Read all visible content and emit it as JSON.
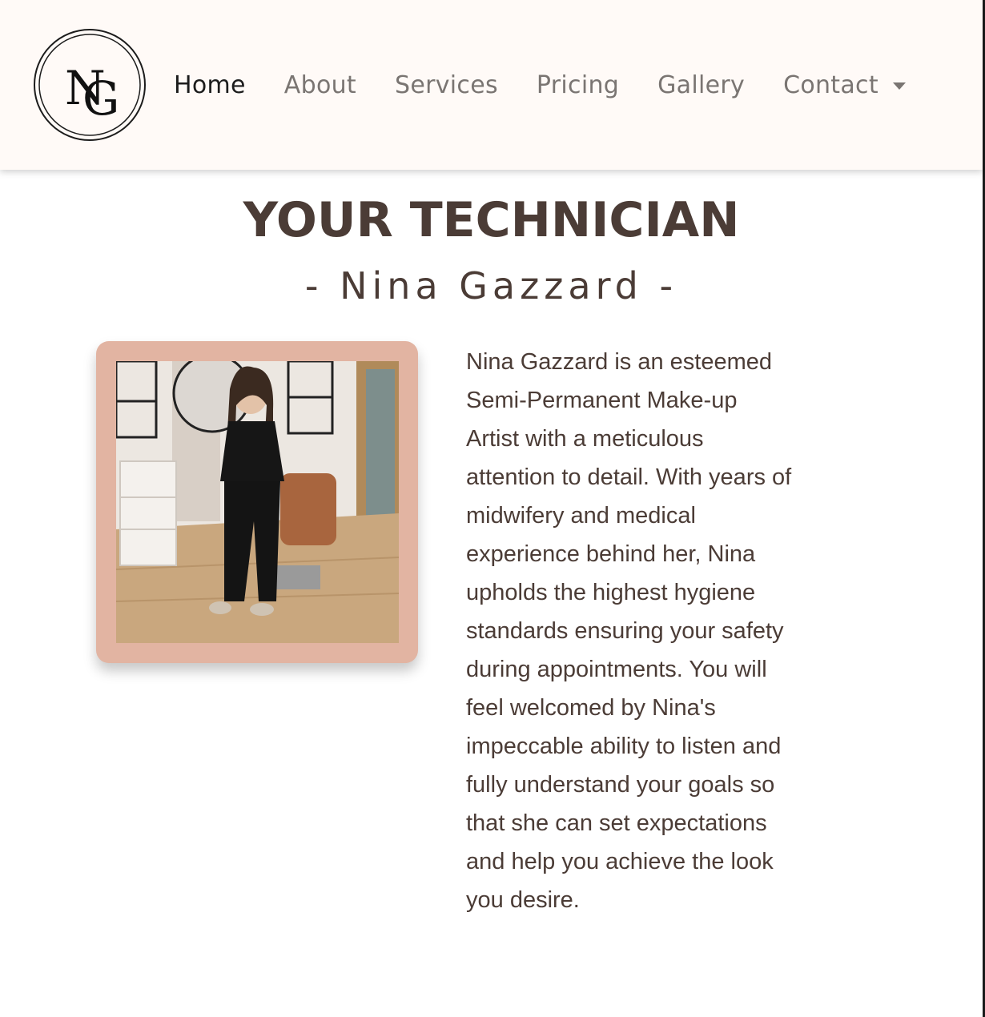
{
  "nav": {
    "logo_label": "NG",
    "links": [
      {
        "label": "Home",
        "active": true
      },
      {
        "label": "About",
        "active": false
      },
      {
        "label": "Services",
        "active": false
      },
      {
        "label": "Pricing",
        "active": false
      },
      {
        "label": "Gallery",
        "active": false
      },
      {
        "label": "Contact",
        "active": false,
        "dropdown": true
      }
    ]
  },
  "section": {
    "title": "YOUR TECHNICIAN",
    "subtitle": "- Nina Gazzard -",
    "photo_icon": "technician-photo",
    "bio": "Nina Gazzard is an esteemed Semi-Permanent Make-up Artist with a meticulous attention to detail. With years of midwifery and medical experience behind her, Nina upholds the highest hygiene standards ensuring your safety during appointments. You will feel welcomed by Nina's impeccable ability to listen and fully understand your goals so that she can set expectations and help you achieve the look you desire."
  },
  "colors": {
    "nav_bg": "#fffaf7",
    "text_dark": "#4b3c36",
    "nav_link": "#7a7572",
    "frame": "#e2b4a2"
  }
}
